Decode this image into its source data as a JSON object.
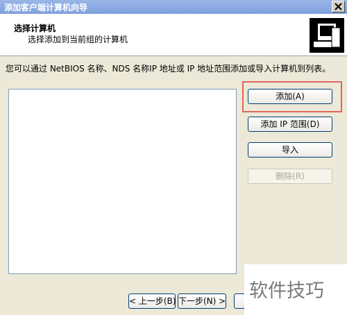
{
  "window": {
    "title": "添加客户端计算机向导"
  },
  "header": {
    "title": "选择计算机",
    "subtitle": "选择添加到当前组的计算机"
  },
  "description": "您可以通过 NetBIOS 名称、NDS 名称IP 地址或 IP 地址范围添加或导入计算机到列表。",
  "buttons": {
    "add": "添加(A)",
    "add_ip_range": "添加 IP 范围(D)",
    "import": "导入",
    "delete": "删除(R)"
  },
  "footer": {
    "back": "< 上一步(B)",
    "next": "下一步(N) >"
  },
  "watermark": "软件技巧",
  "colors": {
    "highlight": "#E0665A",
    "titlebar": "#8AAAE0"
  }
}
